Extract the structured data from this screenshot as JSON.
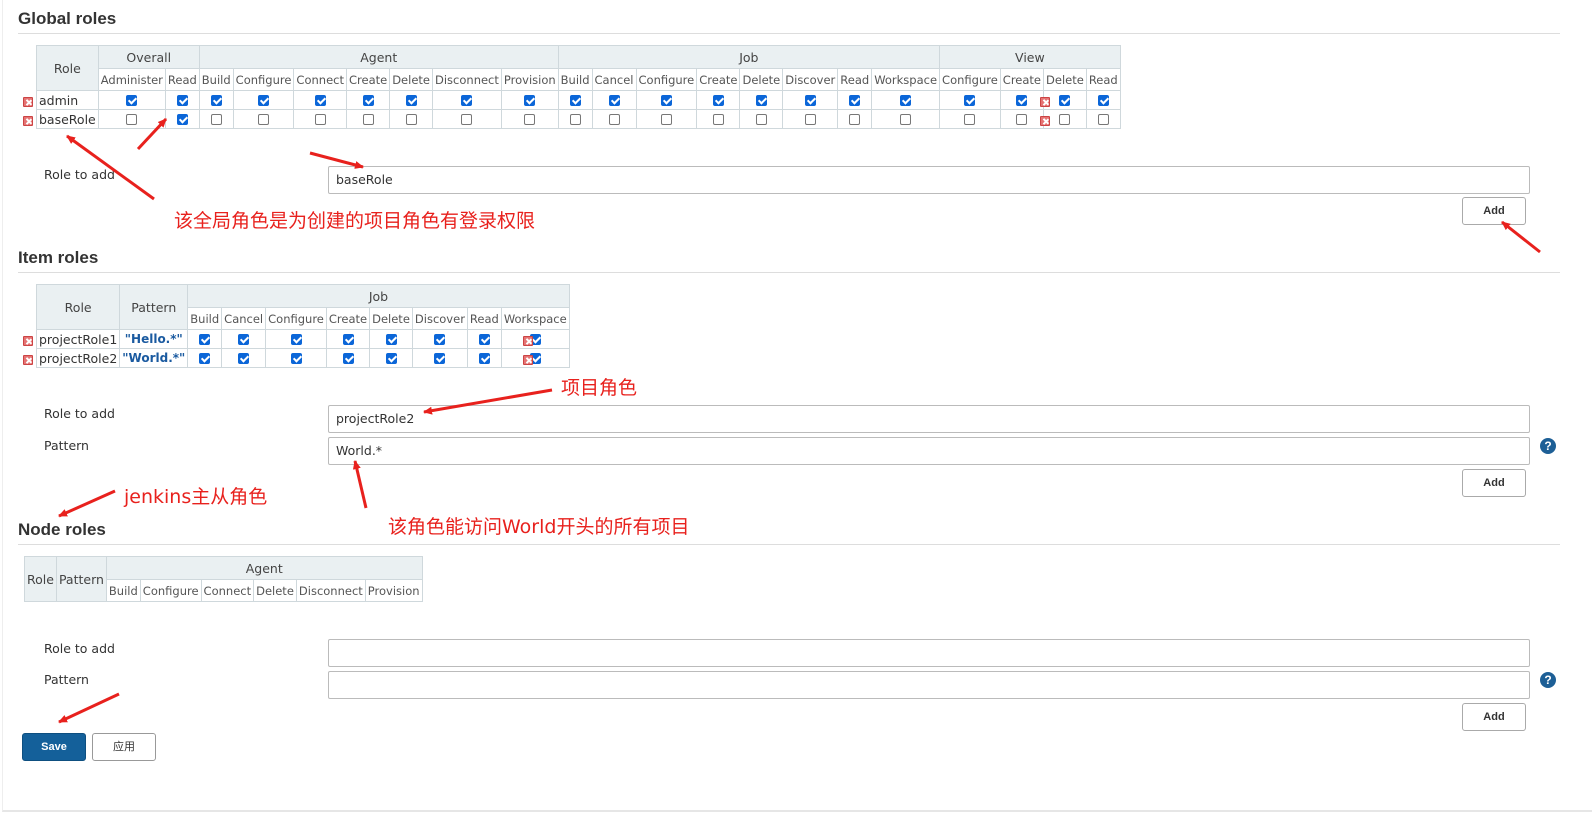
{
  "global_roles": {
    "title": "Global roles",
    "groups": [
      {
        "name": "Overall",
        "perms": [
          "Administer",
          "Read"
        ]
      },
      {
        "name": "Agent",
        "perms": [
          "Build",
          "Configure",
          "Connect",
          "Create",
          "Delete",
          "Disconnect",
          "Provision"
        ]
      },
      {
        "name": "Job",
        "perms": [
          "Build",
          "Cancel",
          "Configure",
          "Create",
          "Delete",
          "Discover",
          "Read",
          "Workspace"
        ]
      },
      {
        "name": "View",
        "perms": [
          "Configure",
          "Create",
          "Delete",
          "Read"
        ]
      }
    ],
    "role_header": "Role",
    "rows": [
      {
        "role": "admin",
        "checks": [
          true,
          true,
          true,
          true,
          true,
          true,
          true,
          true,
          true,
          true,
          true,
          true,
          true,
          true,
          true,
          true,
          true,
          true,
          true,
          true,
          true
        ]
      },
      {
        "role": "baseRole",
        "checks": [
          false,
          true,
          false,
          false,
          false,
          false,
          false,
          false,
          false,
          false,
          false,
          false,
          false,
          false,
          false,
          false,
          false,
          false,
          false,
          false,
          false
        ]
      }
    ],
    "role_to_add_label": "Role to add",
    "role_to_add_value": "baseRole",
    "add_label": "Add"
  },
  "item_roles": {
    "title": "Item roles",
    "role_header": "Role",
    "pattern_header": "Pattern",
    "group": "Job",
    "perms": [
      "Build",
      "Cancel",
      "Configure",
      "Create",
      "Delete",
      "Discover",
      "Read",
      "Workspace"
    ],
    "rows": [
      {
        "role": "projectRole1",
        "pattern": "\"Hello.*\"",
        "checks": [
          true,
          true,
          true,
          true,
          true,
          true,
          true,
          true
        ]
      },
      {
        "role": "projectRole2",
        "pattern": "\"World.*\"",
        "checks": [
          true,
          true,
          true,
          true,
          true,
          true,
          true,
          true
        ]
      }
    ],
    "role_to_add_label": "Role to add",
    "role_to_add_value": "projectRole2",
    "pattern_label": "Pattern",
    "pattern_value": "World.*",
    "add_label": "Add"
  },
  "node_roles": {
    "title": "Node roles",
    "role_header": "Role",
    "pattern_header": "Pattern",
    "group": "Agent",
    "perms": [
      "Build",
      "Configure",
      "Connect",
      "Delete",
      "Disconnect",
      "Provision"
    ],
    "role_to_add_label": "Role to add",
    "role_to_add_value": "",
    "pattern_label": "Pattern",
    "pattern_value": "",
    "add_label": "Add"
  },
  "footer": {
    "save_label": "Save",
    "apply_label": "应用"
  },
  "help_glyph": "?",
  "annotations": {
    "global_note": "该全局角色是为创建的项目角色有登录权限",
    "project_role_note": "项目角色",
    "node_role_note": "jenkins主从角色",
    "pattern_note": "该角色能访问World开头的所有项目"
  },
  "colors": {
    "annotation_red": "#e8211d",
    "save_blue": "#14609a",
    "checkbox_blue": "#0b66d8",
    "header_bg": "#eaf0f2"
  }
}
